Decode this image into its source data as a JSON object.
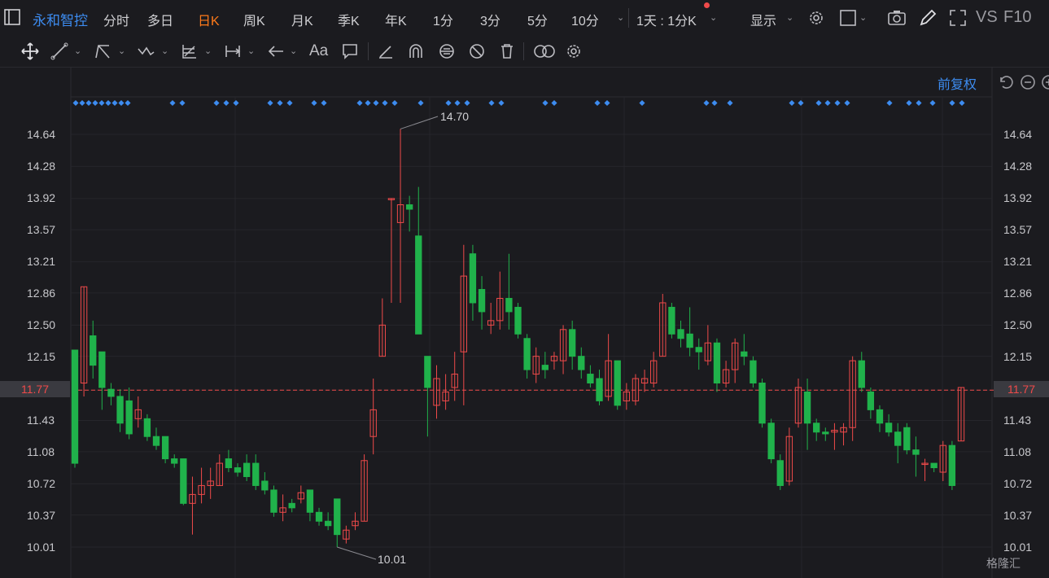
{
  "toolbar": {
    "stock_name": "永和智控",
    "timeframes": [
      "分时",
      "多日",
      "日K",
      "周K",
      "月K",
      "季K",
      "年K",
      "1分",
      "3分",
      "5分",
      "10分"
    ],
    "active_timeframe": "日K",
    "multi_period": "1天 : 1分K",
    "display_label": "显示",
    "vs_label": "VS",
    "f10_label": "F10"
  },
  "drawing_tools": [
    "move-icon",
    "line-icon",
    "polyline-icon",
    "wave-icon",
    "fib-icon",
    "measure-icon",
    "arrow-icon",
    "text-icon",
    "comment-icon",
    "eraser-icon",
    "magnet-icon",
    "lock-icon",
    "hide-icon",
    "delete-icon",
    "compare-icon",
    "settings-icon"
  ],
  "text_tool_label": "Aa",
  "adjust_label": "前复权",
  "colors": {
    "up": "#ef4a4a",
    "down": "#20b24b",
    "accent": "#3d8cf0",
    "active": "#ff7a1a",
    "dot": "#3d8cf0"
  },
  "price_axis": {
    "labels": [
      "14.64",
      "14.28",
      "13.92",
      "13.57",
      "13.21",
      "12.86",
      "12.50",
      "12.15",
      "11.77",
      "11.43",
      "11.08",
      "10.72",
      "10.37",
      "10.01"
    ]
  },
  "current_price": "11.77",
  "annotations": {
    "high": "14.70",
    "low": "10.01"
  },
  "watermark": "格隆汇",
  "chart_data": {
    "type": "candlestick",
    "ylim": [
      10.01,
      14.64
    ],
    "current": 11.77,
    "high_label": 14.7,
    "low_label": 10.01,
    "candles": [
      [
        12.22,
        10.95,
        12.22,
        10.9
      ],
      [
        11.85,
        12.93,
        12.93,
        11.7
      ],
      [
        12.38,
        12.05,
        12.55,
        11.9
      ],
      [
        12.2,
        11.8,
        12.2,
        11.55
      ],
      [
        11.78,
        11.7,
        11.85,
        11.6
      ],
      [
        11.7,
        11.4,
        11.78,
        11.3
      ],
      [
        11.65,
        11.28,
        11.8,
        11.22
      ],
      [
        11.45,
        11.55,
        11.7,
        11.35
      ],
      [
        11.45,
        11.25,
        11.5,
        11.2
      ],
      [
        11.25,
        11.15,
        11.35,
        11.1
      ],
      [
        11.25,
        11.0,
        11.25,
        10.95
      ],
      [
        11.0,
        10.95,
        11.05,
        10.9
      ],
      [
        11.0,
        10.5,
        11.0,
        10.48
      ],
      [
        10.5,
        10.6,
        10.8,
        10.15
      ],
      [
        10.6,
        10.7,
        10.9,
        10.5
      ],
      [
        10.7,
        10.75,
        10.9,
        10.55
      ],
      [
        10.7,
        10.95,
        11.05,
        10.7
      ],
      [
        11.0,
        10.9,
        11.1,
        10.85
      ],
      [
        10.9,
        10.85,
        10.95,
        10.8
      ],
      [
        10.95,
        10.8,
        11.05,
        10.75
      ],
      [
        10.95,
        10.7,
        11.05,
        10.65
      ],
      [
        10.75,
        10.65,
        10.85,
        10.6
      ],
      [
        10.65,
        10.4,
        10.7,
        10.35
      ],
      [
        10.4,
        10.45,
        10.6,
        10.3
      ],
      [
        10.5,
        10.45,
        10.55,
        10.4
      ],
      [
        10.55,
        10.62,
        10.7,
        10.5
      ],
      [
        10.65,
        10.4,
        10.65,
        10.3
      ],
      [
        10.4,
        10.3,
        10.45,
        10.25
      ],
      [
        10.3,
        10.25,
        10.4,
        10.2
      ],
      [
        10.55,
        10.15,
        10.55,
        10.01
      ],
      [
        10.1,
        10.2,
        10.25,
        10.05
      ],
      [
        10.25,
        10.3,
        10.4,
        10.2
      ],
      [
        10.3,
        10.98,
        11.05,
        10.3
      ],
      [
        11.25,
        11.55,
        11.9,
        11.05
      ],
      [
        12.15,
        12.5,
        12.8,
        12.15
      ],
      [
        13.92,
        13.92,
        13.92,
        12.75
      ],
      [
        13.65,
        13.85,
        14.7,
        12.75
      ],
      [
        13.85,
        13.8,
        13.95,
        13.55
      ],
      [
        13.5,
        12.4,
        14.05,
        12.4
      ],
      [
        12.15,
        11.8,
        12.15,
        11.25
      ],
      [
        11.6,
        11.9,
        12.05,
        11.45
      ],
      [
        11.65,
        11.75,
        11.95,
        11.55
      ],
      [
        11.8,
        11.95,
        12.2,
        11.65
      ],
      [
        12.2,
        13.05,
        13.4,
        11.6
      ],
      [
        13.3,
        12.75,
        13.4,
        12.55
      ],
      [
        12.9,
        12.65,
        13.05,
        12.45
      ],
      [
        12.5,
        12.55,
        12.75,
        12.4
      ],
      [
        12.55,
        12.8,
        13.1,
        12.45
      ],
      [
        12.8,
        12.65,
        13.3,
        12.45
      ],
      [
        12.7,
        12.4,
        12.75,
        12.35
      ],
      [
        12.35,
        12.0,
        12.4,
        11.9
      ],
      [
        11.95,
        12.15,
        12.25,
        11.85
      ],
      [
        12.05,
        12.0,
        12.2,
        11.9
      ],
      [
        12.1,
        12.15,
        12.2,
        12.0
      ],
      [
        12.1,
        12.45,
        12.5,
        11.95
      ],
      [
        12.45,
        12.15,
        12.55,
        12.0
      ],
      [
        12.15,
        12.0,
        12.25,
        11.9
      ],
      [
        11.95,
        11.85,
        12.05,
        11.8
      ],
      [
        11.9,
        11.65,
        12.0,
        11.6
      ],
      [
        11.7,
        12.1,
        12.4,
        11.65
      ],
      [
        12.1,
        11.6,
        12.1,
        11.55
      ],
      [
        11.65,
        11.75,
        11.85,
        11.55
      ],
      [
        11.65,
        11.9,
        11.95,
        11.6
      ],
      [
        11.85,
        11.9,
        12.0,
        11.75
      ],
      [
        11.85,
        12.1,
        12.2,
        11.8
      ],
      [
        12.15,
        12.75,
        12.85,
        12.15
      ],
      [
        12.7,
        12.4,
        12.75,
        12.35
      ],
      [
        12.45,
        12.35,
        12.55,
        12.25
      ],
      [
        12.4,
        12.25,
        12.7,
        12.15
      ],
      [
        12.25,
        12.2,
        12.35,
        12.0
      ],
      [
        12.1,
        12.3,
        12.5,
        12.05
      ],
      [
        12.3,
        11.85,
        12.35,
        11.75
      ],
      [
        11.85,
        12.0,
        12.1,
        11.8
      ],
      [
        12.0,
        12.3,
        12.35,
        11.85
      ],
      [
        12.2,
        12.15,
        12.4,
        12.05
      ],
      [
        12.1,
        11.85,
        12.15,
        11.8
      ],
      [
        11.85,
        11.4,
        11.9,
        11.35
      ],
      [
        11.4,
        11.0,
        11.45,
        10.95
      ],
      [
        10.98,
        10.7,
        11.05,
        10.65
      ],
      [
        10.75,
        11.25,
        11.35,
        10.7
      ],
      [
        11.4,
        11.8,
        11.9,
        11.35
      ],
      [
        11.75,
        11.4,
        11.9,
        11.1
      ],
      [
        11.4,
        11.3,
        11.45,
        11.2
      ],
      [
        11.3,
        11.28,
        11.35,
        11.2
      ],
      [
        11.3,
        11.32,
        11.4,
        11.1
      ],
      [
        11.3,
        11.35,
        11.4,
        11.15
      ],
      [
        11.35,
        12.1,
        12.15,
        11.2
      ],
      [
        12.1,
        11.8,
        12.2,
        11.75
      ],
      [
        11.75,
        11.55,
        11.8,
        11.45
      ],
      [
        11.55,
        11.4,
        11.6,
        11.3
      ],
      [
        11.4,
        11.3,
        11.5,
        11.25
      ],
      [
        11.3,
        11.15,
        11.4,
        10.95
      ],
      [
        11.35,
        11.1,
        11.4,
        11.05
      ],
      [
        11.1,
        11.05,
        11.25,
        10.8
      ],
      [
        10.95,
        10.95,
        11.0,
        10.75
      ],
      [
        10.95,
        10.9,
        10.95,
        10.85
      ],
      [
        10.85,
        11.15,
        11.2,
        10.75
      ],
      [
        11.15,
        10.7,
        11.2,
        10.65
      ],
      [
        11.2,
        11.8,
        11.8,
        11.2
      ]
    ],
    "dots_x": [
      93,
      101,
      109,
      117,
      125,
      133,
      141,
      149,
      157,
      212,
      224,
      266,
      278,
      290,
      332,
      344,
      356,
      386,
      398,
      442,
      452,
      462,
      473,
      485,
      517,
      551,
      562,
      574,
      604,
      616,
      670,
      681,
      734,
      746,
      789,
      868,
      878,
      897,
      973,
      984,
      1006,
      1017,
      1029,
      1041,
      1093,
      1117,
      1129,
      1146,
      1170,
      1182
    ]
  }
}
